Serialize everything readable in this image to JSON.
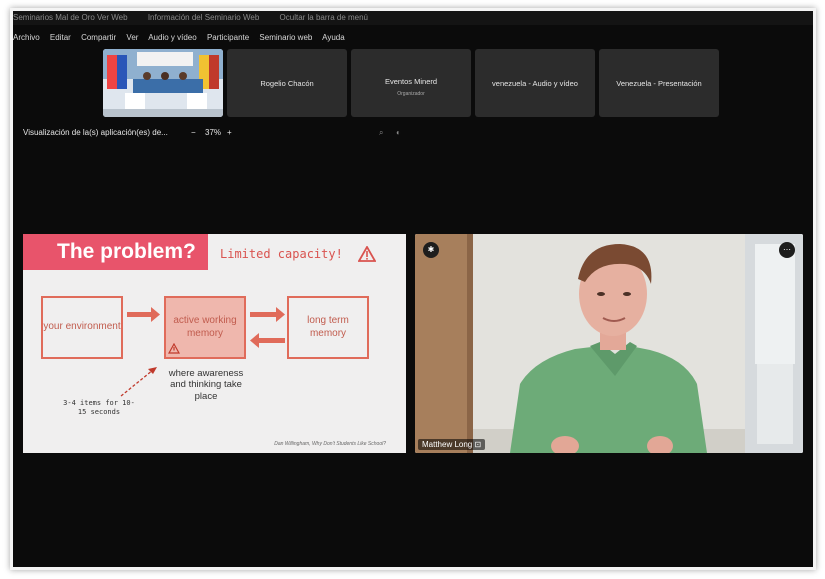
{
  "titlebar": {
    "items": [
      "Seminarios Mal de Oro Ver Web",
      "Información del Seminario Web",
      "Ocultar la barra de menú"
    ]
  },
  "menu": [
    "Archivo",
    "Editar",
    "Compartir",
    "Ver",
    "Audio y vídeo",
    "Participante",
    "Seminario web",
    "Ayuda"
  ],
  "thumbnails": [
    {
      "name": "Rogelio Chacón",
      "sub": ""
    },
    {
      "name": "Eventos Minerd",
      "sub": "Organizador"
    },
    {
      "name": "venezuela - Audio y vídeo",
      "sub": ""
    },
    {
      "name": "Venezuela - Presentación",
      "sub": ""
    }
  ],
  "viewbar": {
    "label": "Visualización de la(s) aplicación(es) de...",
    "minus": "−",
    "zoom": "37%",
    "plus": "+"
  },
  "slide": {
    "title": "The problem?",
    "limited": "Limited capacity!",
    "env": "your environment",
    "active": "active working memory",
    "long": "long term memory",
    "where": "where awareness and thinking take place",
    "items": "3-4 items for 10-15 seconds",
    "credit": "Dan Willingham, Why Don't Students Like School?"
  },
  "video": {
    "speaker": "Matthew Long"
  },
  "colors": {
    "accent": "#e8546b",
    "box": "#e06b5a",
    "active_fill": "#efb7ad"
  }
}
